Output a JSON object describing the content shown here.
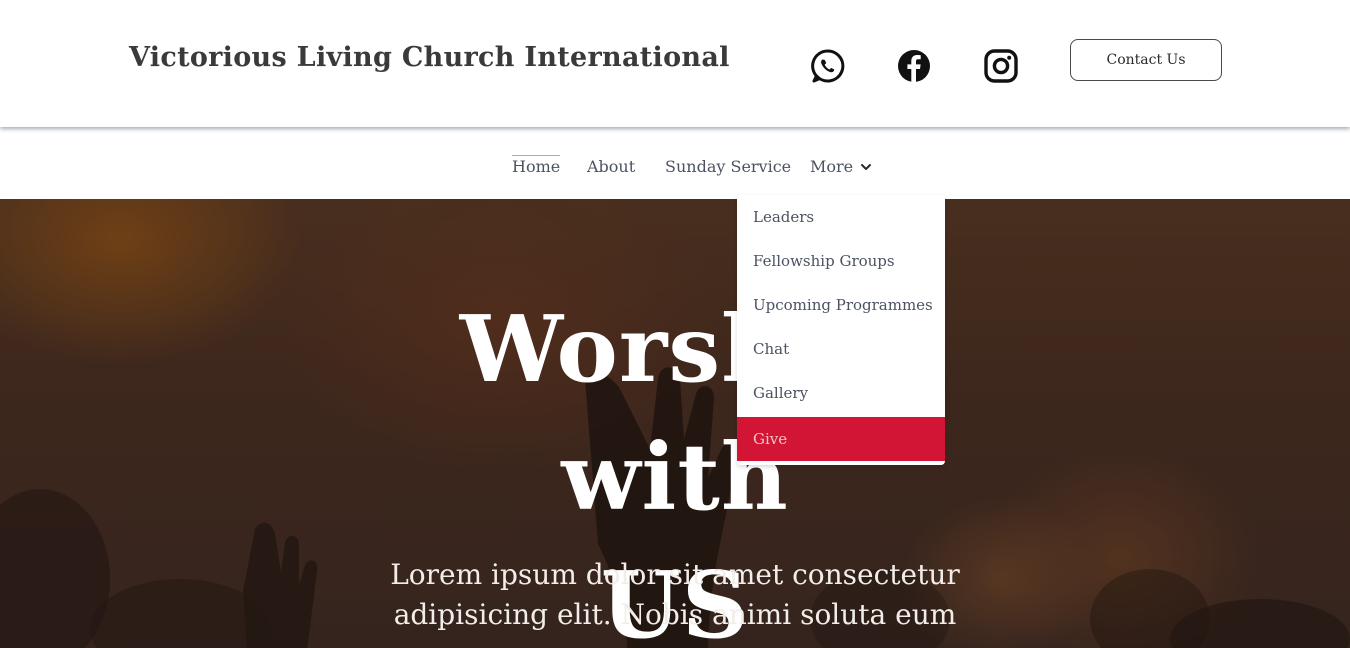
{
  "header": {
    "site_title": "Victorious Living Church International",
    "contact_label": "Contact Us",
    "social_icons": [
      "whatsapp-icon",
      "facebook-icon",
      "instagram-icon"
    ]
  },
  "nav": {
    "items": [
      {
        "label": "Home",
        "active": true
      },
      {
        "label": "About"
      },
      {
        "label": "Sunday Service"
      },
      {
        "label": "More",
        "icon": "chevron-down-icon"
      }
    ]
  },
  "dropdown": {
    "items": [
      {
        "label": "Leaders"
      },
      {
        "label": "Fellowship Groups"
      },
      {
        "label": "Upcoming Programmes"
      },
      {
        "label": "Chat"
      },
      {
        "label": "Gallery"
      },
      {
        "label": "Give",
        "highlighted": true
      }
    ]
  },
  "hero": {
    "title_line1": "Worship with",
    "title_line2": "US",
    "text": "Lorem ipsum dolor sit amet consectetur adipisicing elit. Nobis animi soluta eum"
  },
  "colors": {
    "accent_red": "#d31535",
    "nav_text": "#4b5262",
    "title_text": "#3a3a3a"
  }
}
